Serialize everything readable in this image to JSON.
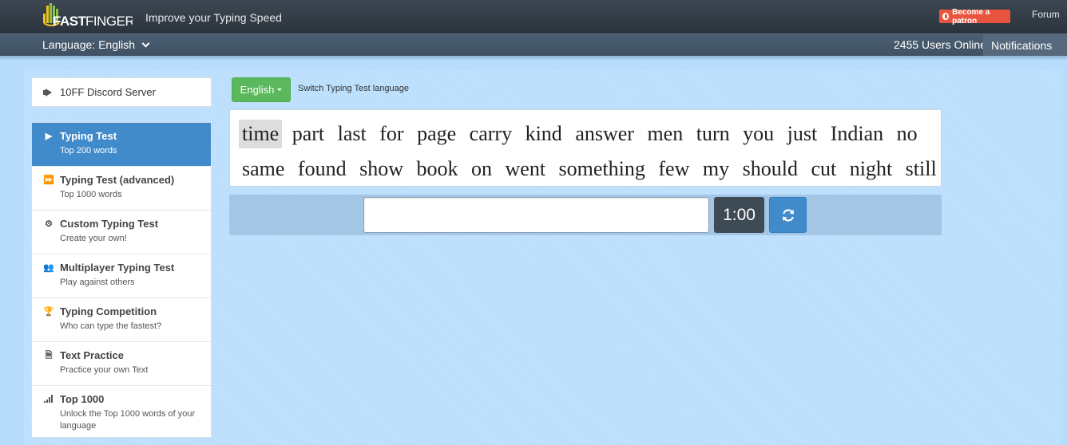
{
  "header": {
    "logo_text": "10FASTFINGERS",
    "tagline": "Improve your Typing Speed",
    "patron_label": "Become a patron",
    "forum_label": "Forum"
  },
  "subheader": {
    "language_label": "Language: English",
    "users_online": "2455 Users Online",
    "notifications_label": "Notifications"
  },
  "sidebar": {
    "discord_label": "10FF Discord Server",
    "items": [
      {
        "title": "Typing Test",
        "subtitle": "Top 200 words",
        "icon": "play-icon",
        "active": true
      },
      {
        "title": "Typing Test (advanced)",
        "subtitle": "Top 1000 words",
        "icon": "fast-forward-icon",
        "active": false
      },
      {
        "title": "Custom Typing Test",
        "subtitle": "Create your own!",
        "icon": "cogs-icon",
        "active": false
      },
      {
        "title": "Multiplayer Typing Test",
        "subtitle": "Play against others",
        "icon": "users-icon",
        "active": false
      },
      {
        "title": "Typing Competition",
        "subtitle": "Who can type the fastest?",
        "icon": "trophy-icon",
        "active": false
      },
      {
        "title": "Text Practice",
        "subtitle": "Practice your own Text",
        "icon": "document-icon",
        "active": false
      },
      {
        "title": "Top 1000",
        "subtitle": "Unlock the Top 1000 words of your language",
        "icon": "signal-icon",
        "active": false
      }
    ]
  },
  "main": {
    "language_button": "English",
    "switch_label": "Switch Typing Test language",
    "words": [
      "time",
      "part",
      "last",
      "for",
      "page",
      "carry",
      "kind",
      "answer",
      "men",
      "turn",
      "you",
      "just",
      "Indian",
      "no",
      "same",
      "found",
      "show",
      "book",
      "on",
      "went",
      "something",
      "few",
      "my",
      "should",
      "cut",
      "night",
      "still"
    ],
    "current_word_index": 0,
    "input_value": "",
    "timer": "1:00"
  },
  "colors": {
    "accent": "#428bca",
    "language_button": "#5cb85c",
    "background": "#b8dcfc",
    "patron": "#e8553e"
  }
}
